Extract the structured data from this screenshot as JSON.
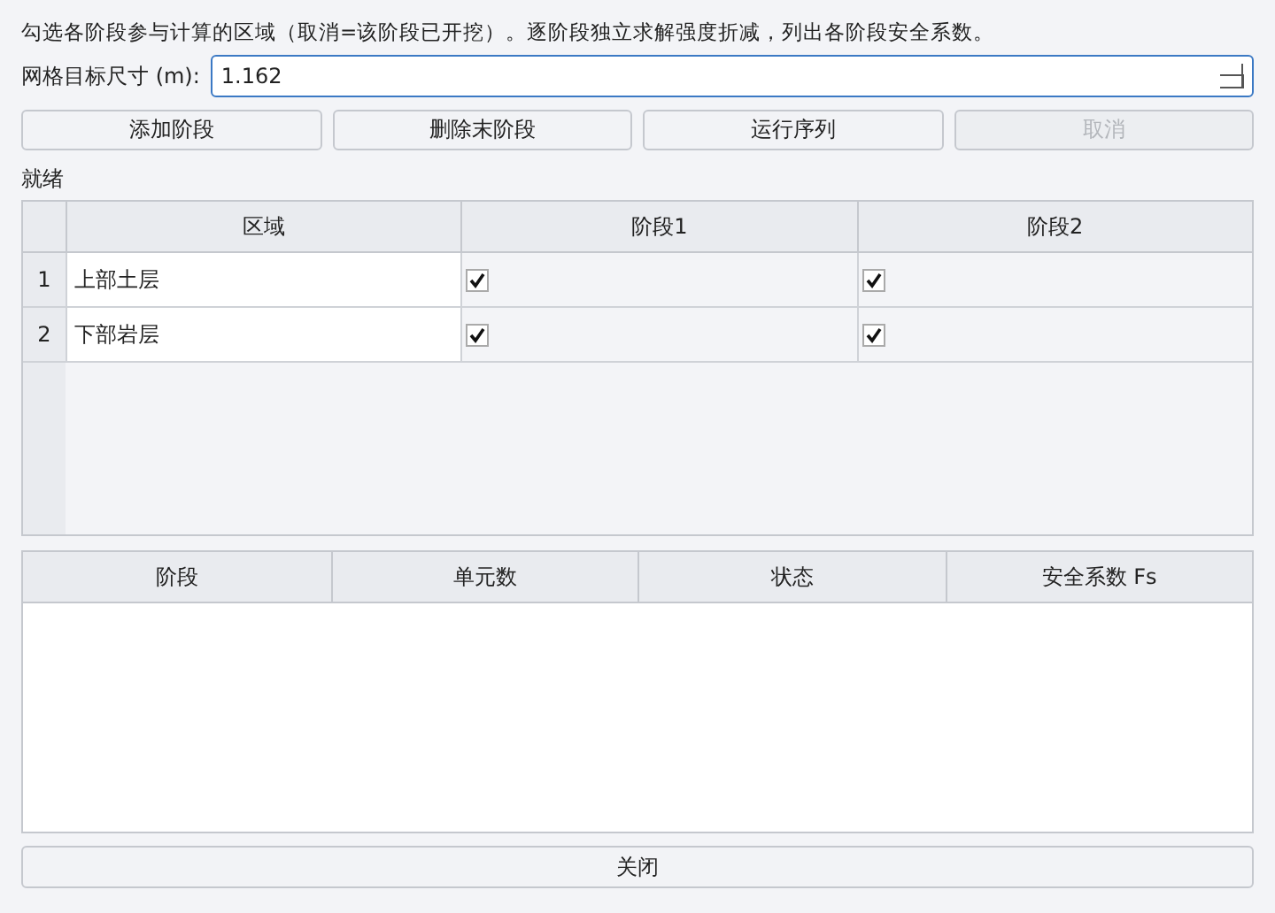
{
  "instructions": "勾选各阶段参与计算的区域（取消=该阶段已开挖）。逐阶段独立求解强度折减，列出各阶段安全系数。",
  "mesh_size": {
    "label": "网格目标尺寸 (m):",
    "value": "1.162"
  },
  "buttons": [
    {
      "label": "添加阶段",
      "disabled": false
    },
    {
      "label": "删除末阶段",
      "disabled": false
    },
    {
      "label": "运行序列",
      "disabled": false
    },
    {
      "label": "取消",
      "disabled": true
    }
  ],
  "status": "就绪",
  "region_table": {
    "columns": [
      "区域",
      "阶段1",
      "阶段2"
    ],
    "rows": [
      {
        "index": "1",
        "name": "上部土层",
        "stages": [
          {
            "checked": true
          },
          {
            "checked": true
          }
        ]
      },
      {
        "index": "2",
        "name": "下部岩层",
        "stages": [
          {
            "checked": true
          },
          {
            "checked": true
          }
        ]
      }
    ]
  },
  "results_table": {
    "columns": [
      "阶段",
      "单元数",
      "状态",
      "安全系数 Fs"
    ]
  },
  "close_button": "关闭"
}
